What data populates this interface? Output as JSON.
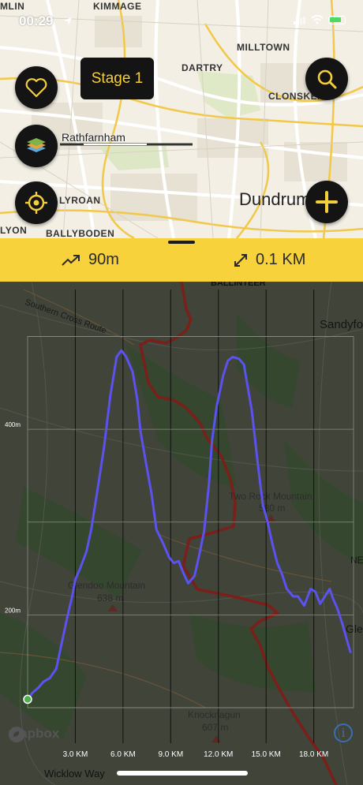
{
  "status_bar": {
    "time": "00:29"
  },
  "top_map": {
    "labels": {
      "kimmage": "KIMMAGE",
      "milltown": "MILLTOWN",
      "dartry": "DARTRY",
      "clonskeagh": "CLONSKEA",
      "rathfarnham": "Rathfarnham",
      "lyroan": "LYROAN",
      "dundrum": "Dundrum",
      "ballyboden": "BALLYBODEN",
      "lyon": "LYON",
      "mlin": "MLIN"
    },
    "stage_button_label": "Stage 1",
    "icons": {
      "favorite": "heart-icon",
      "layers": "layers-icon",
      "locate": "crosshair-icon",
      "search": "search-icon",
      "add": "plus-icon"
    },
    "colors": {
      "accent": "#f5cf3a",
      "button_bg": "#141414"
    }
  },
  "stats": {
    "elevation_gain": "90m",
    "distance": "0.1 KM",
    "bar_color": "#f8d23b"
  },
  "bottom_map": {
    "labels": {
      "ballinteer": "BALLINTEER",
      "sandyford": "Sandyfo",
      "southern_cross": "Southern Cross Route",
      "two_rock": "Two Rock Mountain",
      "two_rock_height": "580 m",
      "glendoo": "Glendoo Mountain",
      "glendoo_height": "638 m",
      "knocknagun": "Knocknagun",
      "knocknagun_height": "607 m",
      "glen": "Gle",
      "wicklow_way": "Wicklow Way",
      "ne": "NE"
    },
    "mapbox": "mapbox",
    "info": "i"
  },
  "chart_data": {
    "type": "line",
    "title": "",
    "xlabel": "",
    "ylabel": "",
    "x_ticks": [
      "3.0 KM",
      "6.0 KM",
      "9.0 KM",
      "12.0 KM",
      "15.0 KM",
      "18.0 KM"
    ],
    "y_ticks": [
      "200m",
      "400m"
    ],
    "xlim": [
      0,
      20.5
    ],
    "ylim": [
      100,
      520
    ],
    "series": [
      {
        "color": "#5b52f0",
        "x": [
          0,
          0.3,
          0.7,
          1.0,
          1.4,
          1.8,
          2.1,
          2.5,
          2.8,
          3.0,
          3.3,
          3.7,
          4.0,
          4.4,
          4.8,
          5.2,
          5.6,
          5.9,
          6.2,
          6.6,
          6.9,
          7.1,
          7.4,
          7.8,
          8.1,
          8.5,
          8.9,
          9.2,
          9.5,
          9.8,
          10.1,
          10.5,
          10.8,
          11.1,
          11.4,
          11.6,
          11.9,
          12.3,
          12.6,
          12.9,
          13.3,
          13.6,
          14.1,
          14.5,
          14.8,
          15.1,
          15.4,
          15.7,
          16.0,
          16.3,
          16.7,
          17.0,
          17.4,
          17.8,
          18.1,
          18.4,
          18.7,
          19.0,
          19.2,
          19.5,
          19.8,
          20.1,
          20.3
        ],
        "y": [
          109,
          116,
          122,
          128,
          132,
          142,
          166,
          198,
          220,
          238,
          250,
          268,
          292,
          335,
          380,
          436,
          478,
          485,
          478,
          462,
          432,
          398,
          368,
          330,
          292,
          278,
          262,
          256,
          258,
          245,
          234,
          242,
          265,
          290,
          340,
          388,
          425,
          458,
          474,
          478,
          476,
          470,
          420,
          360,
          318,
          300,
          276,
          256,
          244,
          228,
          220,
          220,
          210,
          228,
          225,
          212,
          220,
          228,
          218,
          206,
          190,
          172,
          160
        ]
      }
    ]
  }
}
